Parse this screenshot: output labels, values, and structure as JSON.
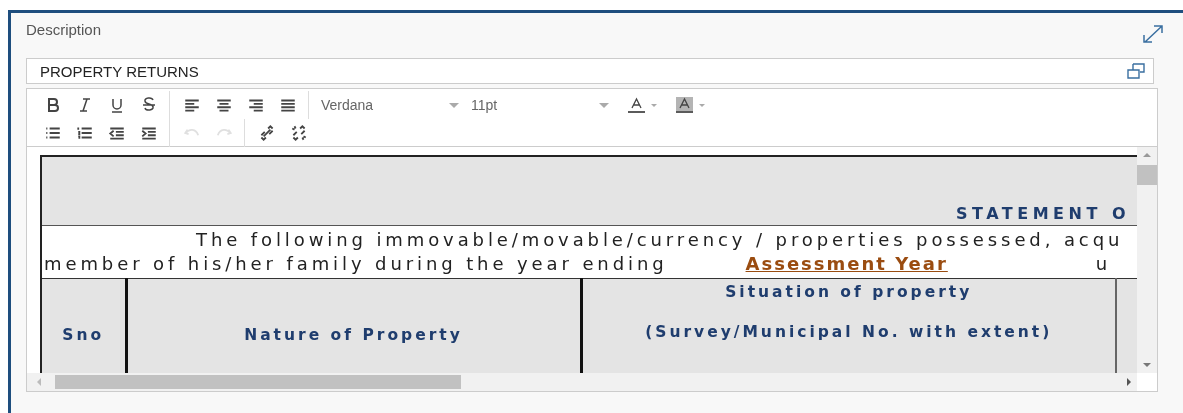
{
  "panel": {
    "title": "Description"
  },
  "subject": {
    "value": "PROPERTY RETURNS"
  },
  "toolbar": {
    "rows": [
      [
        {
          "kind": "bold",
          "disabled": false
        },
        {
          "kind": "italic",
          "disabled": false
        },
        {
          "kind": "underline",
          "disabled": false
        },
        {
          "kind": "strike",
          "disabled": false
        },
        {
          "kind": "sep"
        },
        {
          "kind": "align-left",
          "disabled": false
        },
        {
          "kind": "align-center",
          "disabled": false
        },
        {
          "kind": "align-right",
          "disabled": false
        },
        {
          "kind": "justify",
          "disabled": false
        },
        {
          "kind": "sep"
        },
        {
          "kind": "font",
          "value": "Verdana"
        },
        {
          "kind": "size",
          "value": "11pt"
        },
        {
          "kind": "text-color",
          "disabled": false
        },
        {
          "kind": "highlight",
          "disabled": false
        }
      ],
      [
        {
          "kind": "bullets",
          "disabled": false
        },
        {
          "kind": "numbers",
          "disabled": false
        },
        {
          "kind": "outdent",
          "disabled": false
        },
        {
          "kind": "indent",
          "disabled": false
        },
        {
          "kind": "sep"
        },
        {
          "kind": "undo",
          "disabled": true
        },
        {
          "kind": "redo",
          "disabled": true
        },
        {
          "kind": "sep"
        },
        {
          "kind": "link",
          "disabled": false
        },
        {
          "kind": "unlink",
          "disabled": false
        }
      ]
    ]
  },
  "document": {
    "heading": "STATEMENT O",
    "intro_line_1": "The following immovable/movable/currency / properties possessed, acqu",
    "intro_line_2": "member of his/her family during the year ending",
    "intro_link": "Assessment Year",
    "intro_tail": "u",
    "columns": [
      {
        "lines": [
          "Sno"
        ]
      },
      {
        "lines": [
          "Nature of Property"
        ]
      },
      {
        "lines": [
          "Situation of property",
          "(Survey/Municipal No. with extent)"
        ]
      }
    ]
  }
}
